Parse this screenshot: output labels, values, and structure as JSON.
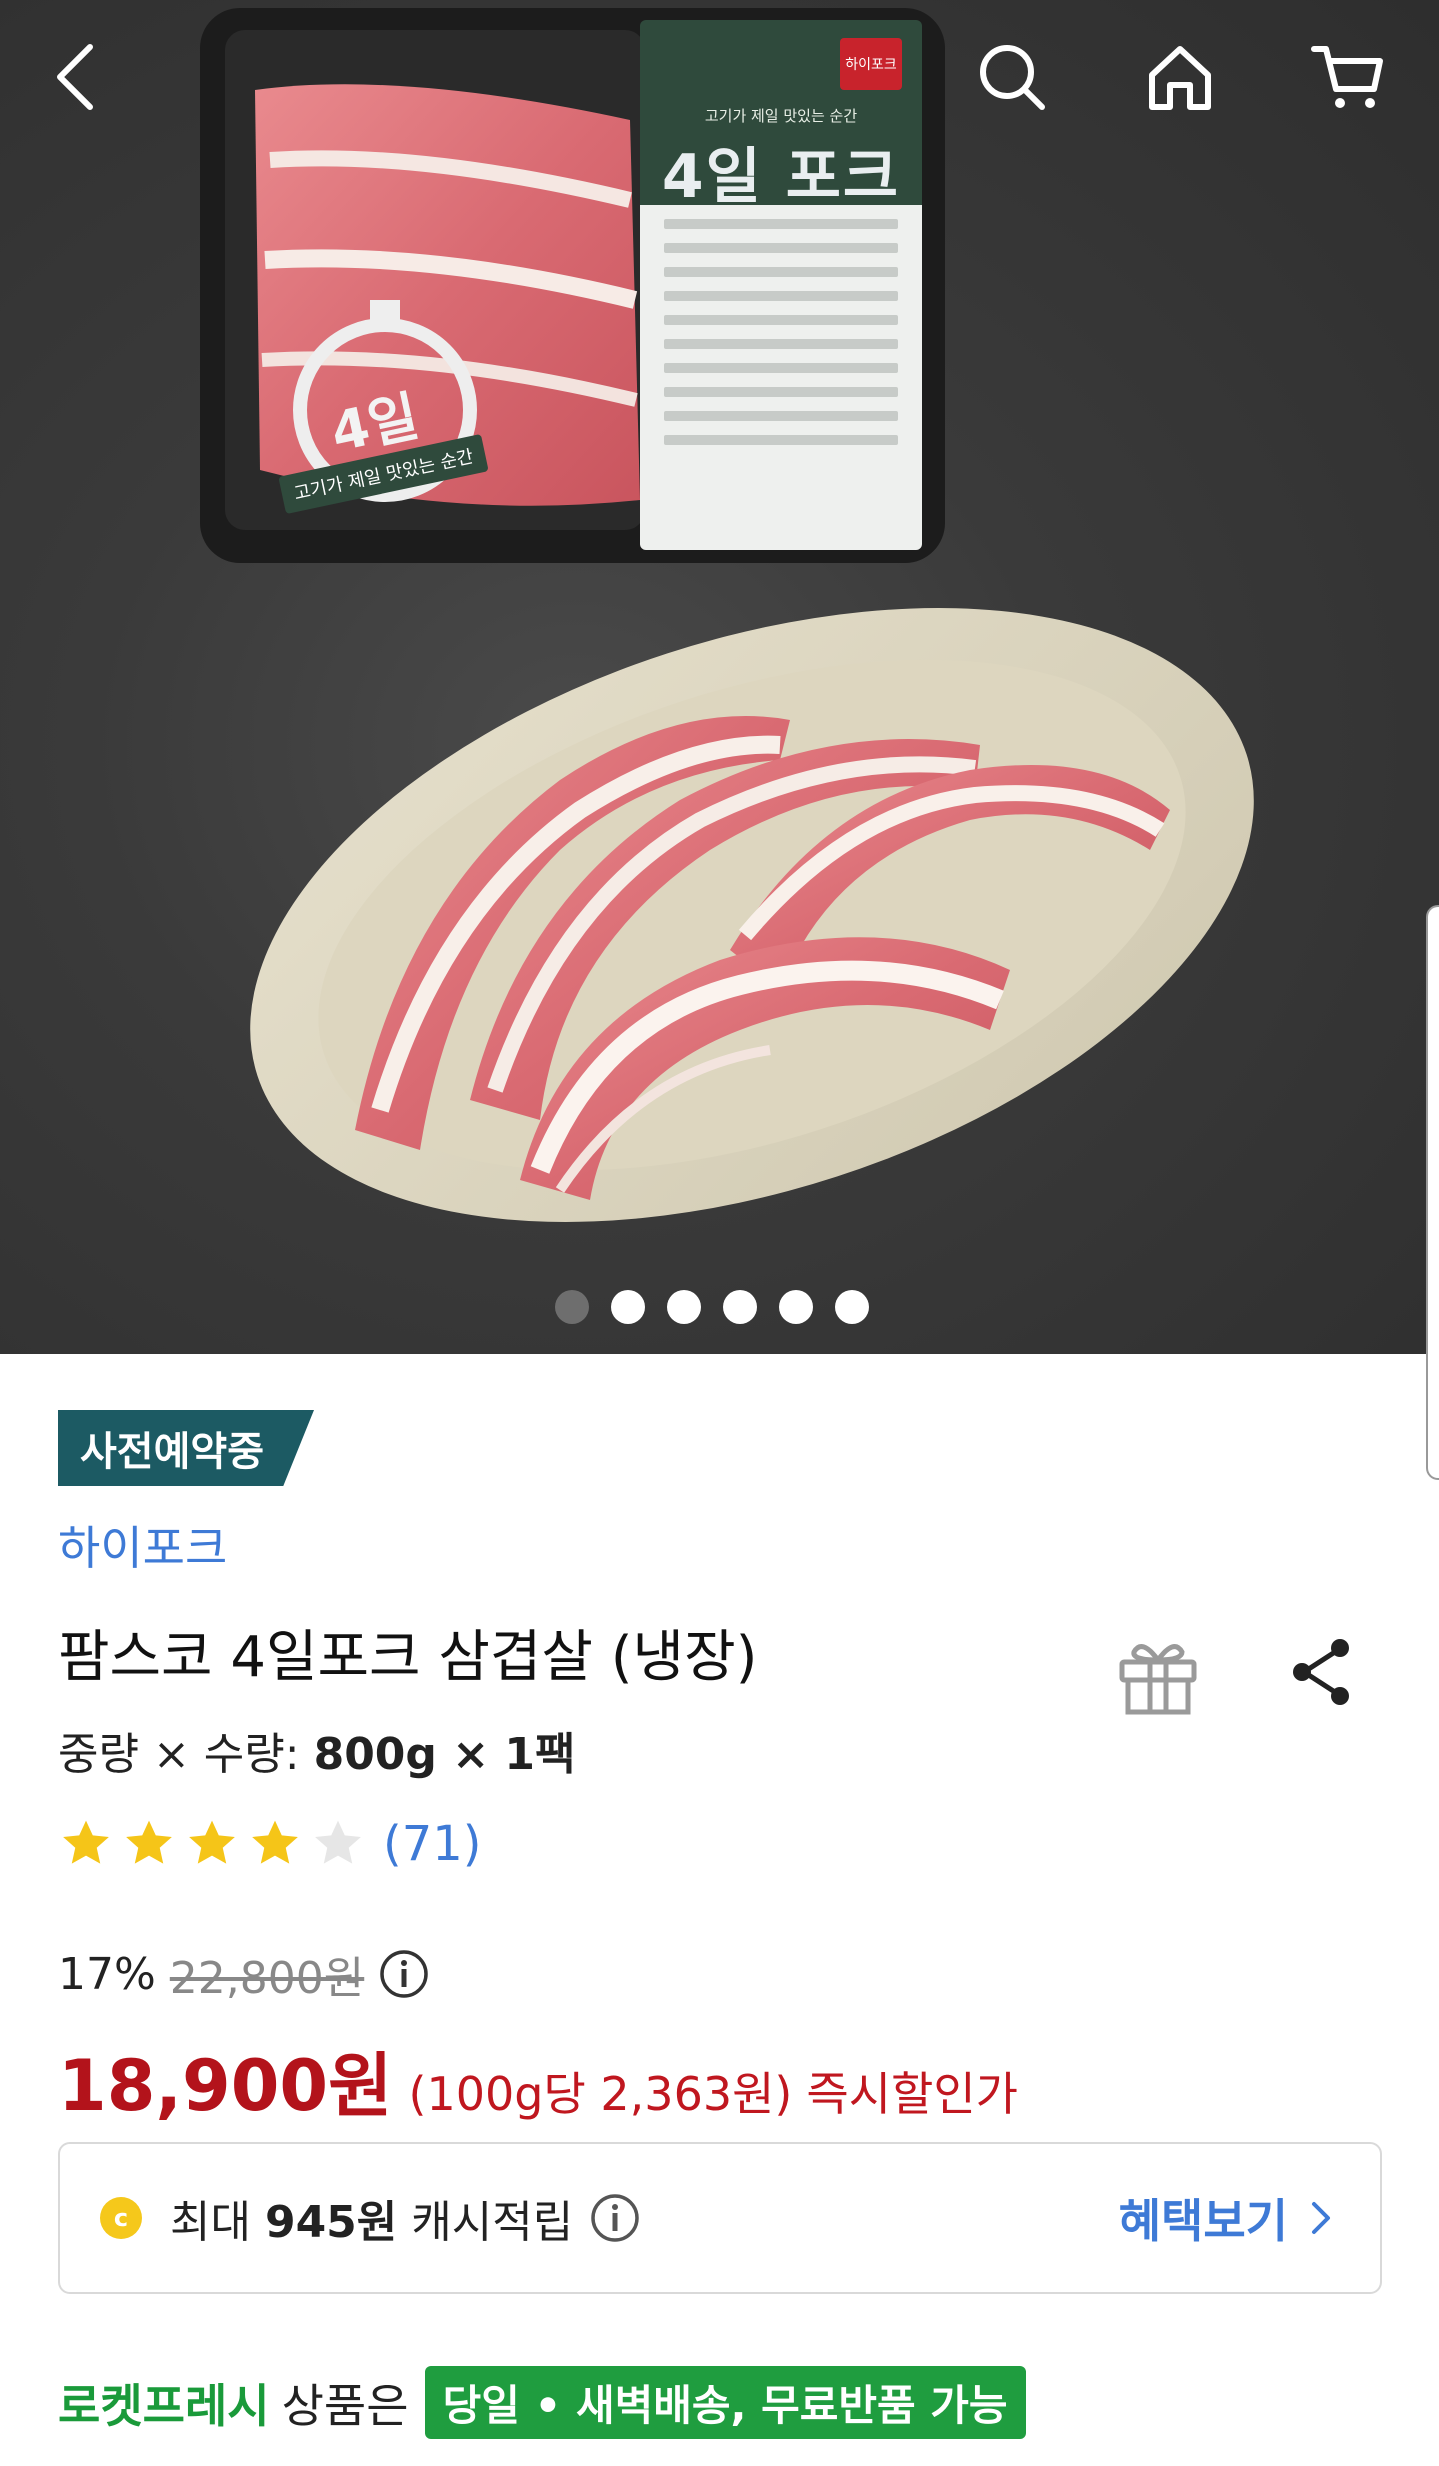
{
  "nav": {
    "back_icon": "chevron-left-icon",
    "search_icon": "search-icon",
    "home_icon": "home-icon",
    "cart_icon": "cart-icon"
  },
  "hero": {
    "package_logo": "하이포크",
    "package_tagline": "고기가 제일 맛있는 순간",
    "package_title": "4일 포크",
    "stopwatch_label": "고기가 제일 맛있는 순간",
    "stopwatch_number": "4일",
    "image_count": 6,
    "active_image_index": 0
  },
  "product": {
    "badge": "사전예약중",
    "seller": "하이포크",
    "title": "팜스코 4일포크 삼겹살 (냉장)",
    "spec_label": "중량 × 수량: ",
    "spec_value": "800g × 1팩",
    "rating_stars": 4,
    "rating_max": 5,
    "review_count": "(71)"
  },
  "price": {
    "discount_rate": "17%",
    "original_price": "22,800원",
    "sale_price": "18,900원",
    "unit_price": "(100g당 2,363원)",
    "instant_label": "즉시할인가"
  },
  "cashback": {
    "prefix": "최대 ",
    "amount": "945원",
    "suffix": " 캐시적립",
    "benefit_link": "혜택보기"
  },
  "fresh": {
    "brand": "로켓프레시",
    "middle": "상품은",
    "pill": "당일 • 새벽배송, 무료반품 가능"
  },
  "colors": {
    "badge_bg": "#1c5a63",
    "link_blue": "#3e7ad6",
    "price_red": "#b3131b",
    "fresh_green": "#1f9d3f",
    "star_yellow": "#f5c518",
    "star_empty": "#e6e6e6"
  }
}
